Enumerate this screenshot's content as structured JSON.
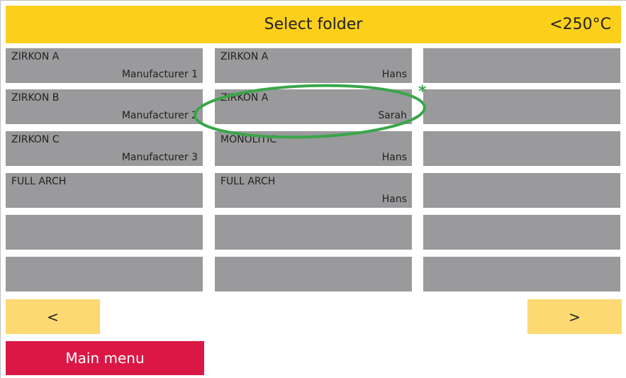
{
  "header": {
    "title": "Select folder",
    "temperature": "<250°C"
  },
  "folders": {
    "col1": [
      {
        "name": "ZIRKON A",
        "owner": "Manufacturer 1"
      },
      {
        "name": "ZIRKON B",
        "owner": "Manufacturer 2"
      },
      {
        "name": "ZIRKON C",
        "owner": "Manufacturer 3"
      },
      {
        "name": "FULL ARCH",
        "owner": ""
      },
      {
        "name": "",
        "owner": ""
      },
      {
        "name": "",
        "owner": ""
      }
    ],
    "col2": [
      {
        "name": "ZIRKON A",
        "owner": "Hans"
      },
      {
        "name": "ZIRKON A",
        "owner": "Sarah"
      },
      {
        "name": "MONOLITIC",
        "owner": "Hans"
      },
      {
        "name": "FULL ARCH",
        "owner": "Hans"
      },
      {
        "name": "",
        "owner": ""
      },
      {
        "name": "",
        "owner": ""
      }
    ],
    "col3": [
      {
        "name": "",
        "owner": ""
      },
      {
        "name": "",
        "owner": ""
      },
      {
        "name": "",
        "owner": ""
      },
      {
        "name": "",
        "owner": ""
      },
      {
        "name": "",
        "owner": ""
      },
      {
        "name": "",
        "owner": ""
      }
    ]
  },
  "annotation": {
    "marker": "*",
    "color": "#3aa64a"
  },
  "nav": {
    "prev_label": "<",
    "next_label": ">"
  },
  "main_menu": {
    "label": "Main menu"
  },
  "colors": {
    "header": "#fccf1b",
    "tile": "#9a9a9c",
    "nav_button": "#fcd973",
    "main_menu": "#db1845"
  }
}
